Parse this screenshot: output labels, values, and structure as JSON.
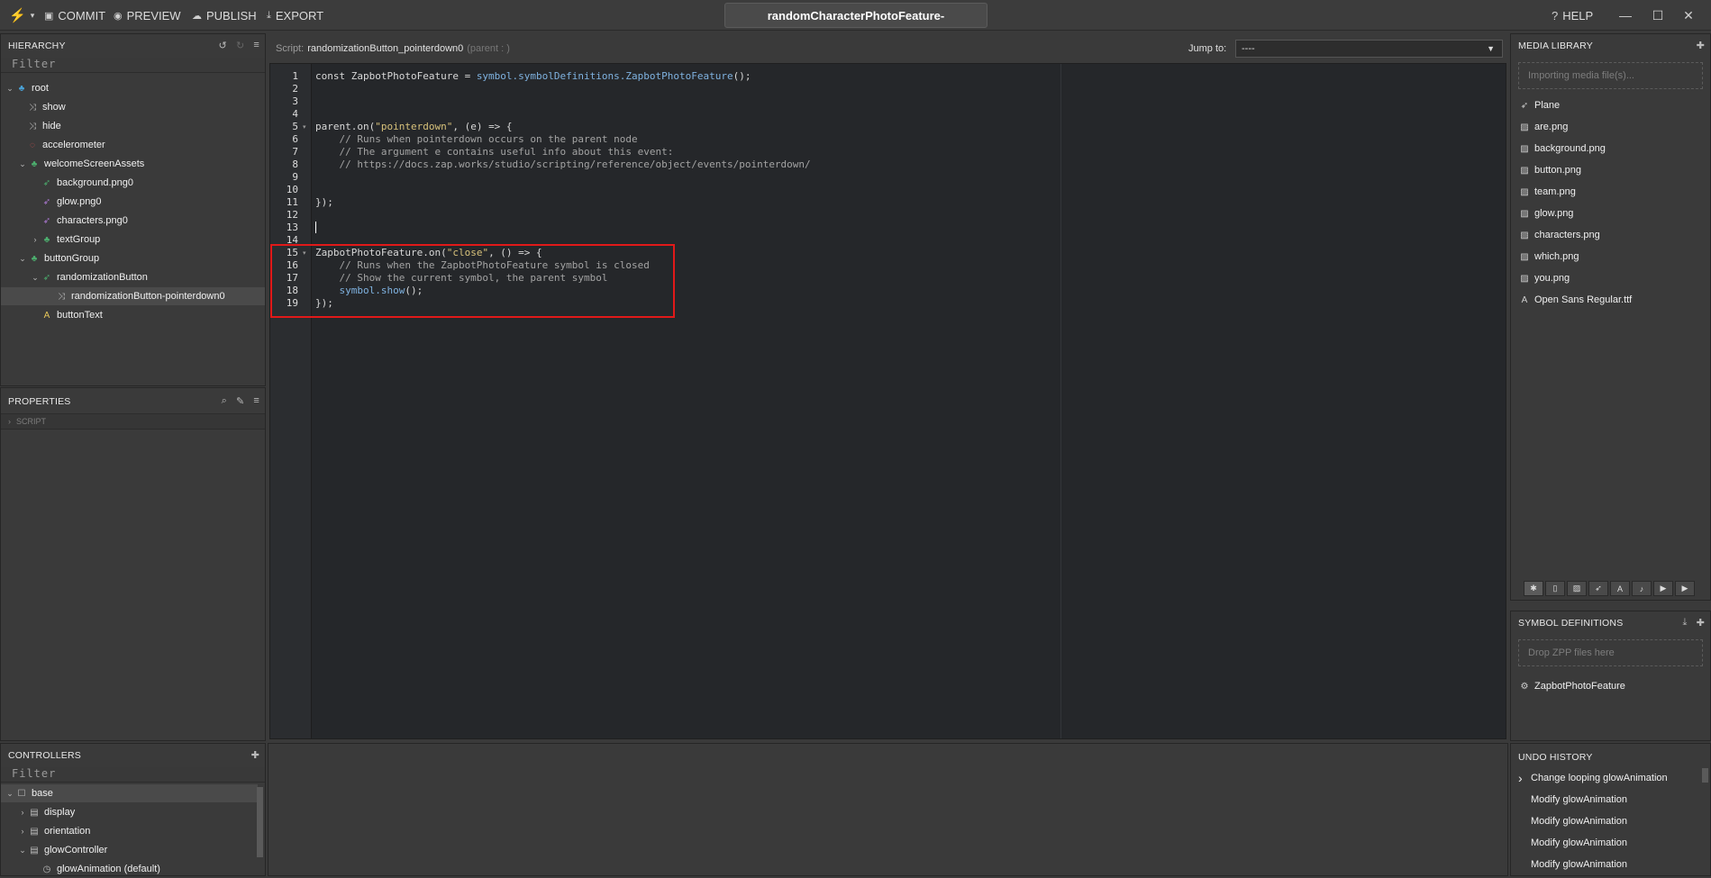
{
  "topbar": {
    "commit": "COMMIT",
    "preview": "PREVIEW",
    "publish": "PUBLISH",
    "export": "EXPORT",
    "project_title": "randomCharacterPhotoFeature-",
    "help": "HELP"
  },
  "hierarchy": {
    "title": "HIERARCHY",
    "filter_placeholder": "Filter",
    "items": [
      {
        "label": "root",
        "icon": "group-icon"
      },
      {
        "label": "show",
        "icon": "shuffle-icon"
      },
      {
        "label": "hide",
        "icon": "shuffle-icon"
      },
      {
        "label": "accelerometer",
        "icon": "accelerometer-icon"
      },
      {
        "label": "welcomeScreenAssets",
        "icon": "group-icon"
      },
      {
        "label": "background.png0",
        "icon": "plane-icon"
      },
      {
        "label": "glow.png0",
        "icon": "plane-icon"
      },
      {
        "label": "characters.png0",
        "icon": "plane-icon"
      },
      {
        "label": "textGroup",
        "icon": "group-icon"
      },
      {
        "label": "buttonGroup",
        "icon": "group-icon"
      },
      {
        "label": "randomizationButton",
        "icon": "plane-icon"
      },
      {
        "label": "randomizationButton-pointerdown0",
        "icon": "script-icon"
      },
      {
        "label": "buttonText",
        "icon": "text-icon"
      }
    ]
  },
  "properties": {
    "title": "PROPERTIES",
    "section": "SCRIPT"
  },
  "controllers": {
    "title": "CONTROLLERS",
    "filter_placeholder": "Filter",
    "items": [
      {
        "label": "base"
      },
      {
        "label": "display"
      },
      {
        "label": "orientation"
      },
      {
        "label": "glowController"
      },
      {
        "label": "glowAnimation (default)"
      }
    ]
  },
  "editor": {
    "script_prefix": "Script:",
    "script_name": "randomizationButton_pointerdown0",
    "parent_note": "(parent : )",
    "jump_label": "Jump to:",
    "jump_value": "----",
    "line_numbers": [
      "1",
      "2",
      "3",
      "4",
      "5",
      "6",
      "7",
      "8",
      "9",
      "10",
      "11",
      "12",
      "13",
      "14",
      "15",
      "16",
      "17",
      "18",
      "19"
    ],
    "lines": {
      "l1_a": "const ZapbotPhotoFeature = ",
      "l1_b": "symbol.symbolDefinitions.ZapbotPhotoFeature",
      "l1_c": "();",
      "l5_a": "parent.on(",
      "l5_b": "\"pointerdown\"",
      "l5_c": ", (e) => {",
      "l6": "    // Runs when pointerdown occurs on the parent node",
      "l7": "    // The argument e contains useful info about this event:",
      "l8": "    // https://docs.zap.works/studio/scripting/reference/object/events/pointerdown/",
      "l11": "});",
      "l15_a": "ZapbotPhotoFeature.on(",
      "l15_b": "\"close\"",
      "l15_c": ", () => {",
      "l16": "    // Runs when the ZapbotPhotoFeature symbol is closed",
      "l17": "    // Show the current symbol, the parent symbol",
      "l18_a": "    ",
      "l18_b": "symbol.show",
      "l18_c": "();",
      "l19": "});"
    }
  },
  "media_library": {
    "title": "MEDIA LIBRARY",
    "drop_text": "Importing media file(s)...",
    "items": [
      {
        "label": "Plane",
        "icon": "plane-icon"
      },
      {
        "label": "are.png",
        "icon": "image-icon"
      },
      {
        "label": "background.png",
        "icon": "image-icon"
      },
      {
        "label": "button.png",
        "icon": "image-icon"
      },
      {
        "label": "team.png",
        "icon": "image-icon"
      },
      {
        "label": "glow.png",
        "icon": "image-icon"
      },
      {
        "label": "characters.png",
        "icon": "image-icon"
      },
      {
        "label": "which.png",
        "icon": "image-icon"
      },
      {
        "label": "you.png",
        "icon": "image-icon"
      },
      {
        "label": "Open Sans Regular.ttf",
        "icon": "font-icon"
      }
    ]
  },
  "symbol_definitions": {
    "title": "SYMBOL DEFINITIONS",
    "drop_text": "Drop ZPP files here",
    "items": [
      {
        "label": "ZapbotPhotoFeature",
        "icon": "gear-icon"
      }
    ]
  },
  "undo_history": {
    "title": "UNDO HISTORY",
    "items": [
      {
        "label": "Change looping glowAnimation"
      },
      {
        "label": "Modify glowAnimation"
      },
      {
        "label": "Modify glowAnimation"
      },
      {
        "label": "Modify glowAnimation"
      },
      {
        "label": "Modify glowAnimation"
      }
    ]
  },
  "colors": {
    "highlight_box": "#e11919",
    "string": "#d7c17a",
    "function": "#7fb2e0",
    "comment": "#a3a3a3"
  }
}
